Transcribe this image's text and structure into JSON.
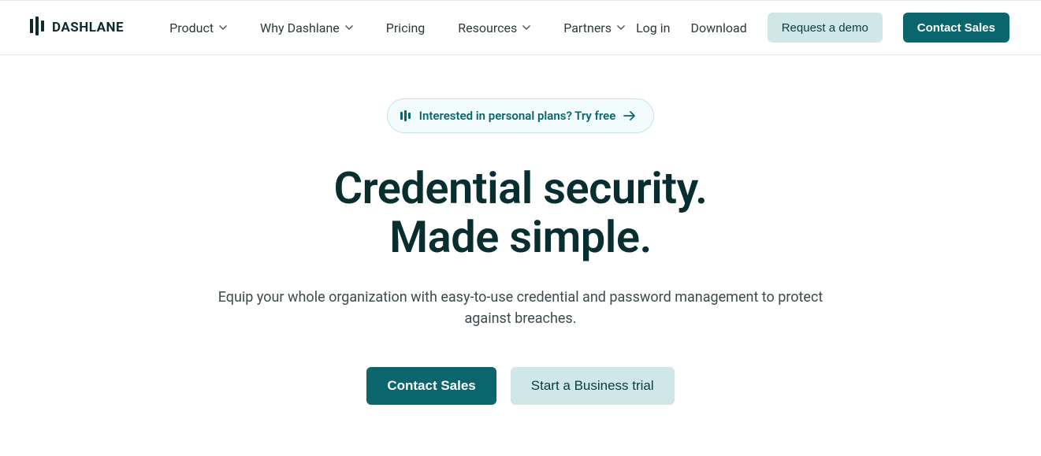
{
  "brand": {
    "name": "DASHLANE"
  },
  "nav": {
    "items": [
      {
        "label": "Product",
        "has_chevron": true
      },
      {
        "label": "Why Dashlane",
        "has_chevron": true
      },
      {
        "label": "Pricing",
        "has_chevron": false
      },
      {
        "label": "Resources",
        "has_chevron": true
      },
      {
        "label": "Partners",
        "has_chevron": true
      }
    ],
    "login": "Log in",
    "download": "Download",
    "demo": "Request a demo",
    "contact": "Contact Sales"
  },
  "hero": {
    "pill": "Interested in personal plans? Try free",
    "title_line1": "Credential security.",
    "title_line2": "Made simple.",
    "subtitle": "Equip your whole organization with easy-to-use credential and password management to protect against breaches.",
    "cta_primary": "Contact Sales",
    "cta_secondary": "Start a Business trial"
  }
}
